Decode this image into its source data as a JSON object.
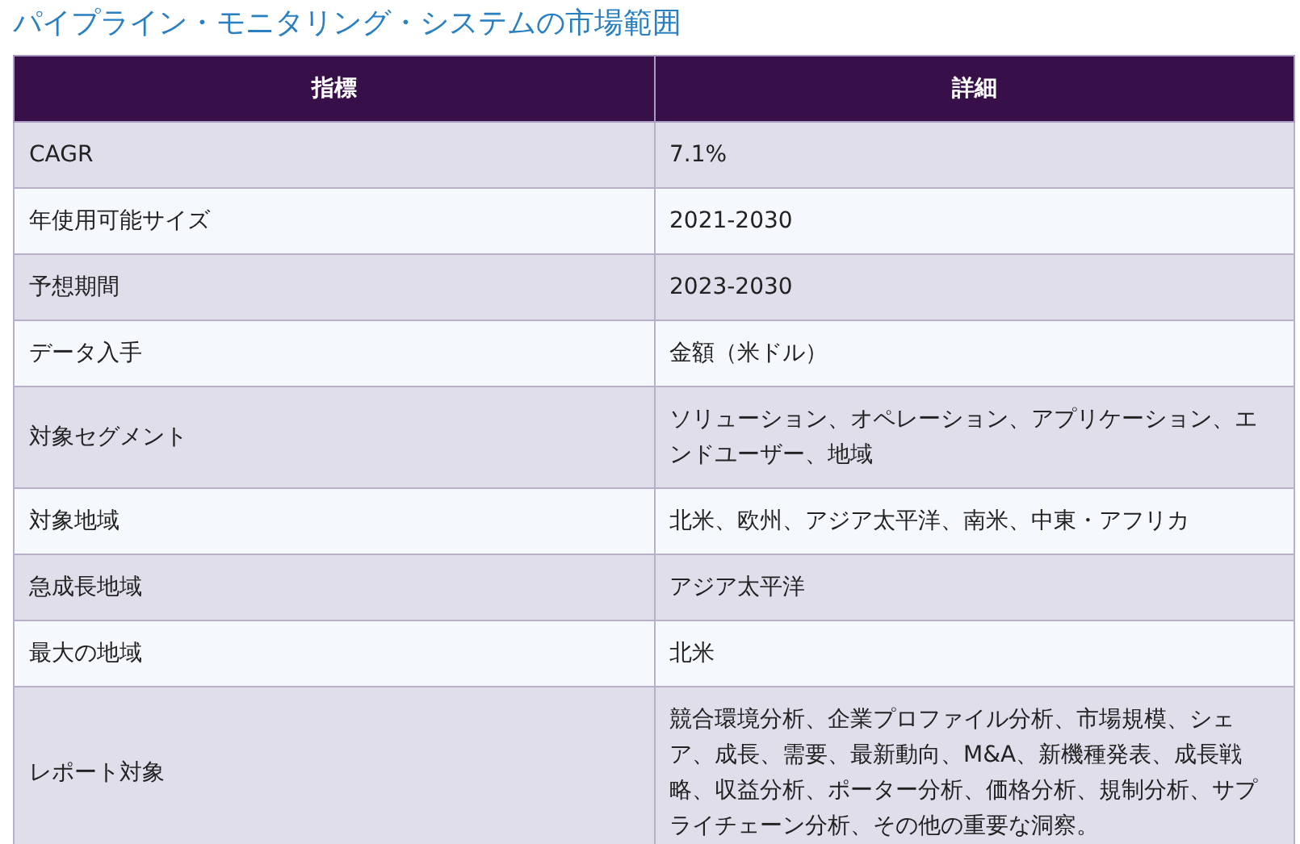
{
  "title": "パイプライン・モニタリング・システムの市場範囲",
  "table": {
    "columns": [
      "指標",
      "詳細"
    ],
    "rows": [
      {
        "label": "CAGR",
        "value": "7.1%"
      },
      {
        "label": "年使用可能サイズ",
        "value": "2021-2030"
      },
      {
        "label": "予想期間",
        "value": "2023-2030"
      },
      {
        "label": "データ入手",
        "value": "金額（米ドル）"
      },
      {
        "label": "対象セグメント",
        "value": "ソリューション、オペレーション、アプリケーション、エンドユーザー、地域"
      },
      {
        "label": "対象地域",
        "value": "北米、欧州、アジア太平洋、南米、中東・アフリカ"
      },
      {
        "label": "急成長地域",
        "value": "アジア太平洋"
      },
      {
        "label": "最大の地域",
        "value": "北米"
      },
      {
        "label": "レポート対象",
        "value": "競合環境分析、企業プロファイル分析、市場規模、シェア、成長、需要、最新動向、M&A、新機種発表、成長戦略、収益分析、ポーター分析、価格分析、規制分析、サプライチェーン分析、その他の重要な洞察。"
      }
    ]
  }
}
